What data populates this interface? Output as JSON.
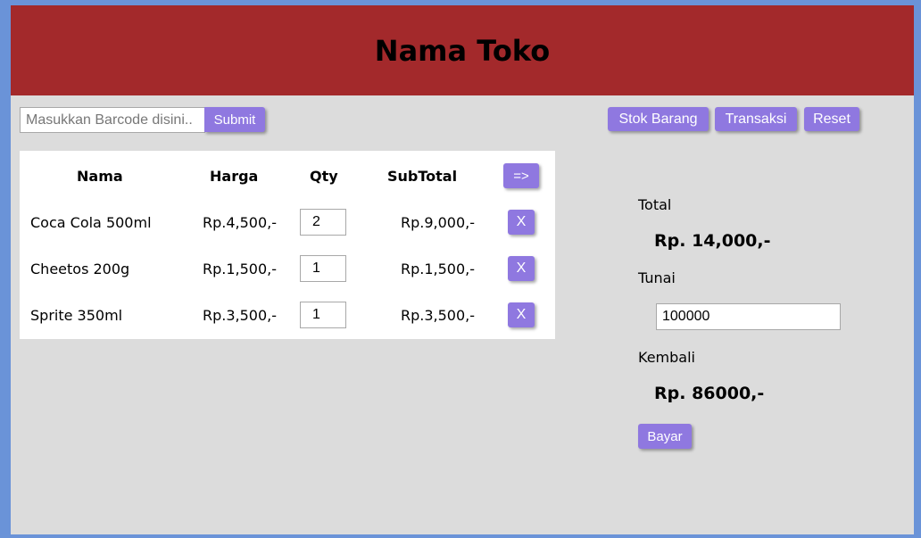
{
  "header": {
    "title": "Nama Toko"
  },
  "barcode": {
    "placeholder": "Masukkan Barcode disini..",
    "value": ""
  },
  "buttons": {
    "submit": "Submit",
    "stok_barang": "Stok Barang",
    "transaksi": "Transaksi",
    "reset": "Reset",
    "arrow": "=>",
    "remove": "X",
    "bayar": "Bayar"
  },
  "cart": {
    "columns": [
      "Nama",
      "Harga",
      "Qty",
      "SubTotal"
    ],
    "rows": [
      {
        "nama": "Coca Cola 500ml",
        "harga": "Rp.4,500,-",
        "qty": "2",
        "subtotal": "Rp.9,000,-"
      },
      {
        "nama": "Cheetos 200g",
        "harga": "Rp.1,500,-",
        "qty": "1",
        "subtotal": "Rp.1,500,-"
      },
      {
        "nama": "Sprite 350ml",
        "harga": "Rp.3,500,-",
        "qty": "1",
        "subtotal": "Rp.3,500,-"
      }
    ]
  },
  "summary": {
    "total_label": "Total",
    "total_value": "Rp. 14,000,-",
    "tunai_label": "Tunai",
    "tunai_value": "100000",
    "kembali_label": "Kembali",
    "kembali_value": "Rp. 86000,-"
  },
  "colors": {
    "header_bg": "#a3292b",
    "button_bg": "#8f78e0",
    "page_bg": "#dcdcdc",
    "frame_bg": "#6a93d8"
  }
}
